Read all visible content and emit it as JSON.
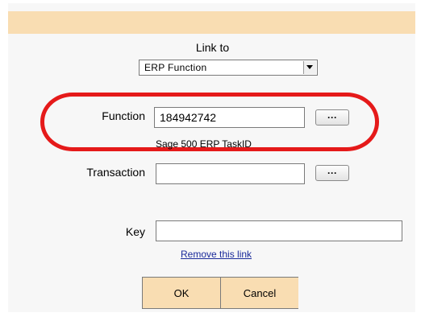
{
  "header": {
    "link_to_label": "Link to"
  },
  "link_type_select": {
    "value": "ERP Function"
  },
  "function_row": {
    "label": "Function",
    "value": "184942742",
    "browse_label": "···",
    "hint": "Sage 500 ERP TaskID"
  },
  "transaction_row": {
    "label": "Transaction",
    "value": "",
    "browse_label": "···"
  },
  "key_row": {
    "label": "Key",
    "value": ""
  },
  "remove_link_label": "Remove this link",
  "buttons": {
    "ok_label": "OK",
    "cancel_label": "Cancel"
  },
  "colors": {
    "accent_bar": "#f9ddb2",
    "highlight": "#e51a1a",
    "link": "#1a2a9a"
  },
  "icons": {
    "dropdown": "chevron-down-icon"
  }
}
